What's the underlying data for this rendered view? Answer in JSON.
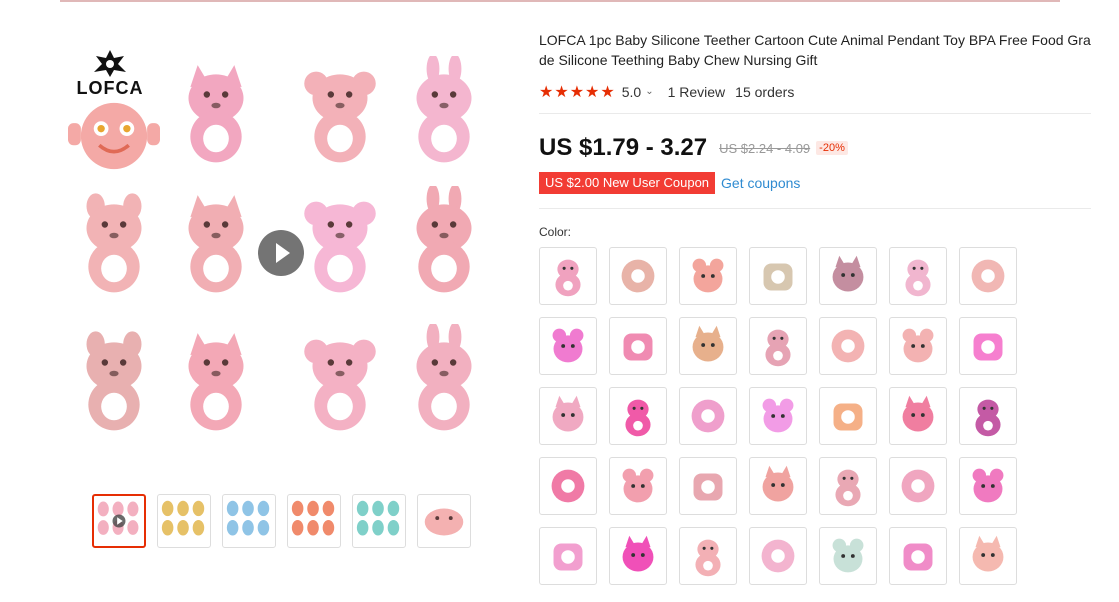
{
  "product": {
    "title": "LOFCA 1pc Baby Silicone Teether Cartoon Cute Animal Pendant Toy BPA Free Food Grade Silicone Teething Baby Chew Nursing Gift",
    "stars": "★★★★★",
    "rating": "5.0",
    "reviews": "1 Review",
    "orders": "15 orders",
    "price": "US $1.79 - 3.27",
    "old_price": "US $2.24 - 4.09",
    "discount": "-20%",
    "coupon": "US $2.00 New User Coupon",
    "get_coupons": "Get coupons",
    "color_label": "Color:"
  },
  "gallery": {
    "logo_text": "LOFCA",
    "toys": [
      {
        "name": "face-teether-icon",
        "color": "#f4a9a6"
      },
      {
        "name": "crown-teether-icon",
        "color": "#f2a7c0"
      },
      {
        "name": "beaver-teether-icon",
        "color": "#f3b1b8"
      },
      {
        "name": "bunny-teether-icon",
        "color": "#f4b6cf"
      },
      {
        "name": "raccoon-teether-icon",
        "color": "#f2b3b5"
      },
      {
        "name": "mouse-teether-icon",
        "color": "#f1aeb3"
      },
      {
        "name": "unicorn-teether-icon",
        "color": "#f6b7d5"
      },
      {
        "name": "turtle-teether-icon",
        "color": "#f1a9b3"
      },
      {
        "name": "fox-teether-icon",
        "color": "#e8b0b0"
      },
      {
        "name": "elephant-teether-icon",
        "color": "#f3a8b6"
      },
      {
        "name": "cat-teether-icon",
        "color": "#f4b1c4"
      },
      {
        "name": "koala-teether-icon",
        "color": "#f2b0c0"
      }
    ],
    "thumbs": [
      {
        "name": "thumb-collage",
        "color": "#f3b0c0"
      },
      {
        "name": "thumb-giraffes",
        "color": "#e6c167"
      },
      {
        "name": "thumb-blue-animals",
        "color": "#8fc4e6"
      },
      {
        "name": "thumb-mixed-animals",
        "color": "#f08a6b"
      },
      {
        "name": "thumb-pineapples",
        "color": "#7fd0c9"
      },
      {
        "name": "thumb-pink-pig",
        "color": "#f4b1b1"
      }
    ]
  },
  "swatches": [
    {
      "name": "swatch-giraffe",
      "color": "#f0a2bf"
    },
    {
      "name": "swatch-mouse",
      "color": "#e8b3a8"
    },
    {
      "name": "swatch-face",
      "color": "#f3a59c"
    },
    {
      "name": "swatch-gift-box",
      "color": "#d7c7b0"
    },
    {
      "name": "swatch-elephant-unicorn",
      "color": "#c48ea0"
    },
    {
      "name": "swatch-crown",
      "color": "#f1b6cf"
    },
    {
      "name": "swatch-hamster",
      "color": "#f1b7b4"
    },
    {
      "name": "swatch-donut",
      "color": "#f07bd0"
    },
    {
      "name": "swatch-pineapple",
      "color": "#f08bb2"
    },
    {
      "name": "swatch-deer-ring",
      "color": "#e7b08c"
    },
    {
      "name": "swatch-raccoon",
      "color": "#e6a3b4"
    },
    {
      "name": "swatch-owl-small",
      "color": "#f3b3b3"
    },
    {
      "name": "swatch-beaver",
      "color": "#f3b2b2"
    },
    {
      "name": "swatch-elephants",
      "color": "#f67fcf"
    },
    {
      "name": "swatch-koala",
      "color": "#f0a9c2"
    },
    {
      "name": "swatch-seahorse",
      "color": "#f05aa8"
    },
    {
      "name": "swatch-cat",
      "color": "#ef9fcc"
    },
    {
      "name": "swatch-egg",
      "color": "#f29ce6"
    },
    {
      "name": "swatch-elephant-yellow",
      "color": "#f5b087"
    },
    {
      "name": "swatch-owl-pink",
      "color": "#f07ea0"
    },
    {
      "name": "swatch-owl-purple",
      "color": "#c45aa5"
    },
    {
      "name": "swatch-turtle",
      "color": "#f07aa6"
    },
    {
      "name": "swatch-turtle-2",
      "color": "#f29fae"
    },
    {
      "name": "swatch-kitten",
      "color": "#e8a7b0"
    },
    {
      "name": "swatch-circle",
      "color": "#f0a3a0"
    },
    {
      "name": "swatch-fox",
      "color": "#e9a8b4"
    },
    {
      "name": "swatch-crown-2",
      "color": "#f0a6c0"
    },
    {
      "name": "swatch-unicorn",
      "color": "#f07ac0"
    },
    {
      "name": "swatch-slipper",
      "color": "#f29fcf"
    },
    {
      "name": "swatch-octopus",
      "color": "#f050b8"
    },
    {
      "name": "swatch-camera",
      "color": "#f3b0b5"
    },
    {
      "name": "swatch-bunny",
      "color": "#f3b4cf"
    },
    {
      "name": "swatch-teapot",
      "color": "#c8e1d8"
    },
    {
      "name": "swatch-hand",
      "color": "#f08cc8"
    },
    {
      "name": "swatch-baby-face",
      "color": "#f5b9b0"
    }
  ]
}
